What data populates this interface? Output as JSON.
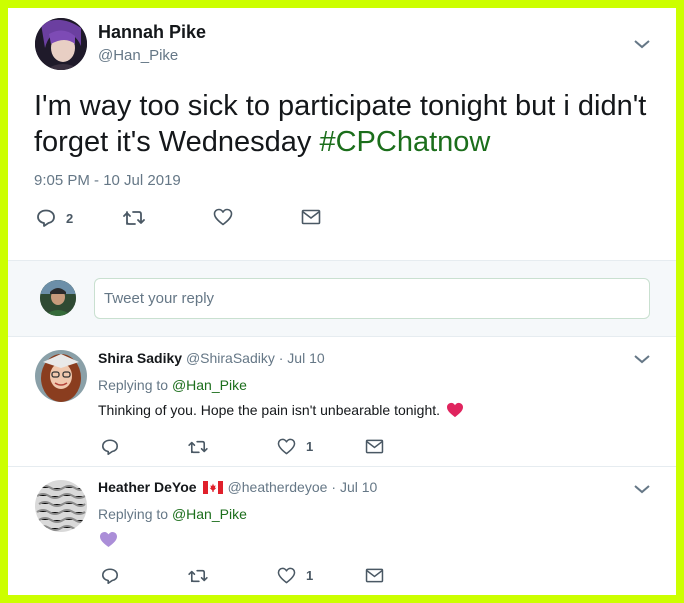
{
  "tweet": {
    "author_name": "Hannah Pike",
    "author_handle": "@Han_Pike",
    "text_before": "I'm way too sick to participate tonight but i didn't forget it's Wednesday ",
    "hashtag": "#CPChatnow",
    "timestamp": "9:05 PM - 10 Jul 2019",
    "reply_count": "2",
    "retweet_count": "",
    "like_count": ""
  },
  "reply_box": {
    "placeholder": "Tweet your reply"
  },
  "replies": [
    {
      "author_name": "Shira Sadiky",
      "author_handle": "@ShiraSadiky",
      "date": "· Jul 10",
      "replying_label": "Replying to",
      "replying_handle": "@Han_Pike",
      "text": "Thinking of you. Hope the pain isn't unbearable tonight.",
      "emoji": "red-heart",
      "like_count": "1"
    },
    {
      "author_name": "Heather DeYoe",
      "author_flag": "canada-flag",
      "author_handle": "@heatherdeyoe",
      "date": "· Jul 10",
      "replying_label": "Replying to",
      "replying_handle": "@Han_Pike",
      "emoji": "purple-heart",
      "like_count": "1"
    }
  ],
  "colors": {
    "frame": "#ccff00",
    "link_green": "#1b6e1b",
    "muted": "#657786",
    "divider": "#e6ecf0",
    "red_heart": "#e0245e",
    "purple_heart": "#ab8ed8"
  }
}
